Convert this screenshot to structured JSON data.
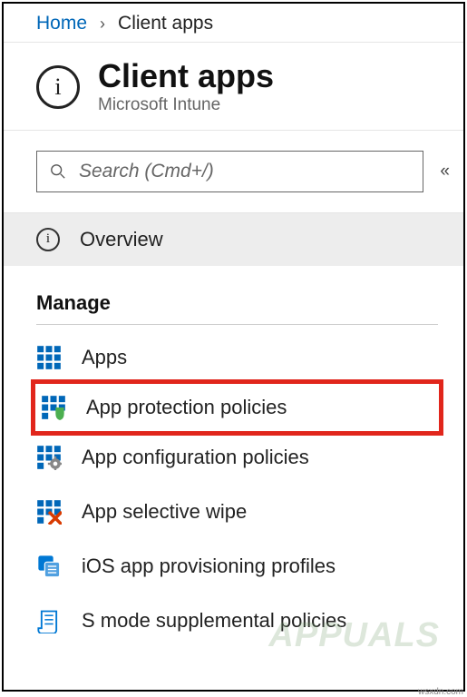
{
  "breadcrumb": {
    "home": "Home",
    "current": "Client apps"
  },
  "header": {
    "title": "Client apps",
    "subtitle": "Microsoft Intune"
  },
  "search": {
    "placeholder": "Search (Cmd+/)"
  },
  "nav": {
    "overview": "Overview",
    "section_manage": "Manage",
    "items": [
      {
        "label": "Apps"
      },
      {
        "label": "App protection policies"
      },
      {
        "label": "App configuration policies"
      },
      {
        "label": "App selective wipe"
      },
      {
        "label": "iOS app provisioning profiles"
      },
      {
        "label": "S mode supplemental policies"
      }
    ]
  },
  "watermark": "APPUALS",
  "credit": "wsxdn.com"
}
